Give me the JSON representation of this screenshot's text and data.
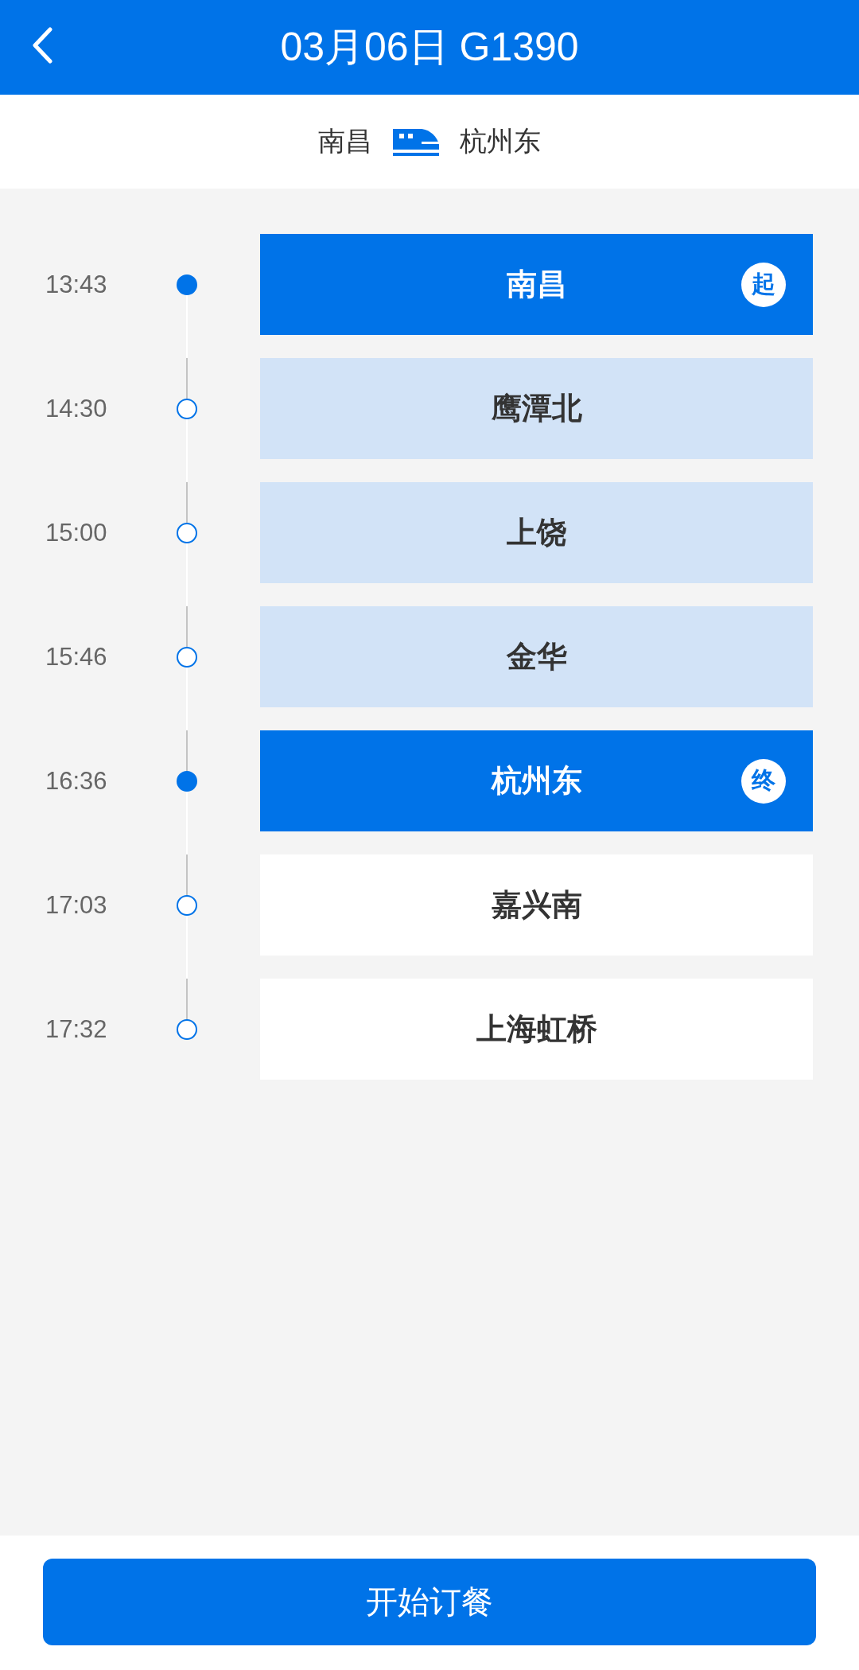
{
  "header": {
    "title": "03月06日 G1390"
  },
  "route": {
    "from": "南昌",
    "to": "杭州东"
  },
  "stops": [
    {
      "time": "13:43",
      "station": "南昌",
      "kind": "endpoint",
      "badge": "起"
    },
    {
      "time": "14:30",
      "station": "鹰潭北",
      "kind": "passed"
    },
    {
      "time": "15:00",
      "station": "上饶",
      "kind": "passed"
    },
    {
      "time": "15:46",
      "station": "金华",
      "kind": "passed"
    },
    {
      "time": "16:36",
      "station": "杭州东",
      "kind": "endpoint",
      "badge": "终"
    },
    {
      "time": "17:03",
      "station": "嘉兴南",
      "kind": "beyond"
    },
    {
      "time": "17:32",
      "station": "上海虹桥",
      "kind": "beyond"
    }
  ],
  "order_button": "开始订餐"
}
